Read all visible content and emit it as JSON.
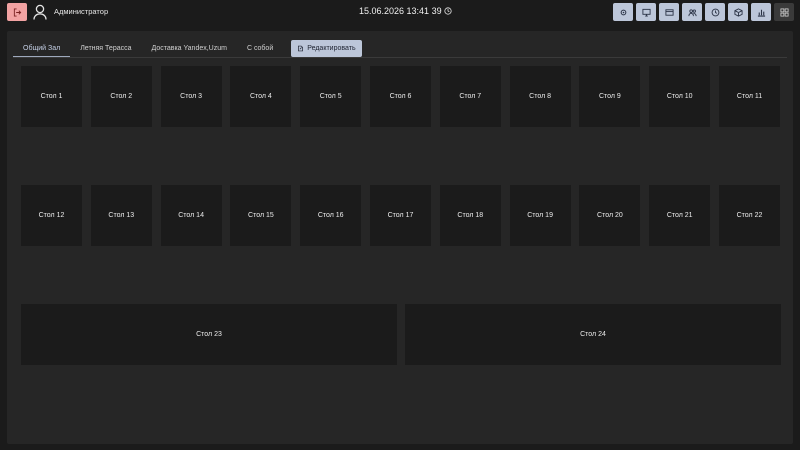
{
  "header": {
    "user_name": "Администратор",
    "datetime": "15.06.2026 13:41 39"
  },
  "icons": {
    "logout": "logout-icon",
    "user": "user-icon",
    "clock": "clock-icon",
    "tools": [
      "settings-icon",
      "monitor-icon",
      "payment-icon",
      "users-icon",
      "history-icon",
      "box-icon",
      "stats-icon",
      "grid-icon"
    ]
  },
  "colors": {
    "accent": "#bcc6d9",
    "logout": "#f2a3a3",
    "background": "#1b1b1b",
    "panel": "#262626"
  },
  "tabs": [
    {
      "label": "Общий Зал",
      "active": true
    },
    {
      "label": "Летняя Терасса",
      "active": false
    },
    {
      "label": "Доставка Yandex,Uzum",
      "active": false
    },
    {
      "label": "С собой",
      "active": false
    }
  ],
  "edit_label": "Редактировать",
  "tables": [
    "Стол 1",
    "Стол 2",
    "Стол 3",
    "Стол 4",
    "Стол 5",
    "Стол 6",
    "Стол 7",
    "Стол 8",
    "Стол 9",
    "Стол 10",
    "Стол 11",
    "Стол 12",
    "Стол 13",
    "Стол 14",
    "Стол 15",
    "Стол 16",
    "Стол 17",
    "Стол 18",
    "Стол 19",
    "Стол 20",
    "Стол 21",
    "Стол 22",
    "Стол 23",
    "Стол 24"
  ]
}
